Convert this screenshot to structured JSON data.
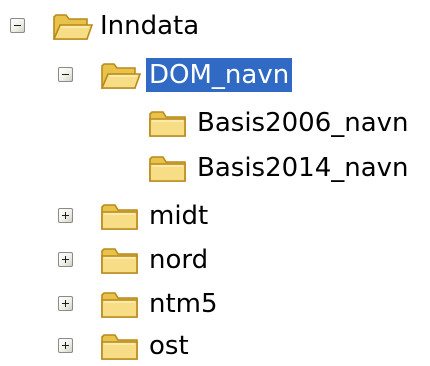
{
  "tree": {
    "items": [
      {
        "label": "Inndata",
        "expanded": true,
        "has_children": true,
        "selected": false
      },
      {
        "label": "DOM_navn",
        "expanded": true,
        "has_children": true,
        "selected": true
      },
      {
        "label": "Basis2006_navn",
        "has_children": false,
        "selected": false
      },
      {
        "label": "Basis2014_navn",
        "has_children": false,
        "selected": false
      },
      {
        "label": "midt",
        "expanded": false,
        "has_children": true,
        "selected": false
      },
      {
        "label": "nord",
        "expanded": false,
        "has_children": true,
        "selected": false
      },
      {
        "label": "ntm5",
        "expanded": false,
        "has_children": true,
        "selected": false
      },
      {
        "label": "ost",
        "expanded": false,
        "has_children": true,
        "selected": false
      }
    ]
  },
  "colors": {
    "selection_bg": "#316ac5",
    "selection_text": "#ffffff",
    "folder_fill": "#f3d77a",
    "folder_edge": "#b88a1c"
  },
  "icons": {
    "folder_open": "folder-open-icon",
    "folder_closed": "folder-icon",
    "expand": "expand-toggle-icon",
    "collapse": "collapse-toggle-icon"
  }
}
